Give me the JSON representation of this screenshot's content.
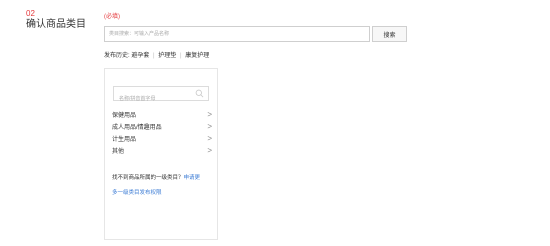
{
  "step": {
    "number": "02",
    "title": "确认商品类目"
  },
  "category_search": {
    "required_label": "(必填)",
    "placeholder": "类目搜索：可输入产品名称",
    "value": "",
    "button_label": "搜索"
  },
  "history": {
    "label": "发布历史:",
    "items": [
      "避孕套",
      "护理垫",
      "康复护理"
    ],
    "separator": "|"
  },
  "panel": {
    "search_placeholder": "名称/拼音首字母",
    "categories": [
      {
        "label": "保健用品"
      },
      {
        "label": "成人用品/情趣用品"
      },
      {
        "label": "计生用品"
      },
      {
        "label": "其他"
      }
    ],
    "chevron": ">",
    "no_category_text": "找不到商品所属的一级类目？",
    "apply_link": "申请更",
    "permission_link": "多一级类目发布权限"
  },
  "colors": {
    "accent_red": "#e4393c",
    "link_blue": "#3a7bd5",
    "border": "#cfcfcf"
  }
}
